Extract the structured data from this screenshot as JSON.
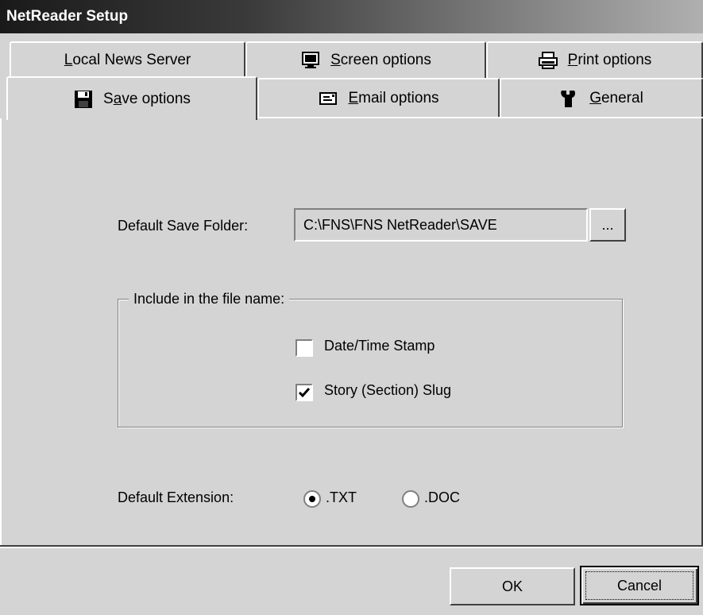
{
  "window": {
    "title": "NetReader Setup"
  },
  "tabs": {
    "row1": [
      {
        "label": "Local News Server",
        "underline": "L",
        "rest": "ocal News Server",
        "icon": ""
      },
      {
        "label": "Screen options",
        "underline": "S",
        "rest": "creen options",
        "icon": "monitor-icon"
      },
      {
        "label": "Print options",
        "underline": "P",
        "rest": "rint options",
        "icon": "printer-icon"
      }
    ],
    "row2": [
      {
        "label": "Save options",
        "pre": "S",
        "underline": "a",
        "rest": "ve options",
        "icon": "floppy-disk-icon",
        "active": true
      },
      {
        "label": "Email options",
        "underline": "E",
        "rest": "mail options",
        "icon": "envelope-icon"
      },
      {
        "label": "General",
        "underline": "G",
        "rest": "eneral",
        "icon": "wrench-icon"
      }
    ]
  },
  "save": {
    "folder_label": "Default Save Folder:",
    "folder_value": "C:\\FNS\\FNS NetReader\\SAVE",
    "browse_label": "...",
    "group_label": "Include in the file name:",
    "date_stamp_label": "Date/Time Stamp",
    "date_stamp_checked": false,
    "slug_label": "Story (Section) Slug",
    "slug_checked": true,
    "ext_label": "Default Extension:",
    "ext_txt_label": ".TXT",
    "ext_doc_label": ".DOC",
    "ext_selected": ".TXT"
  },
  "buttons": {
    "ok": "OK",
    "cancel": "Cancel"
  }
}
